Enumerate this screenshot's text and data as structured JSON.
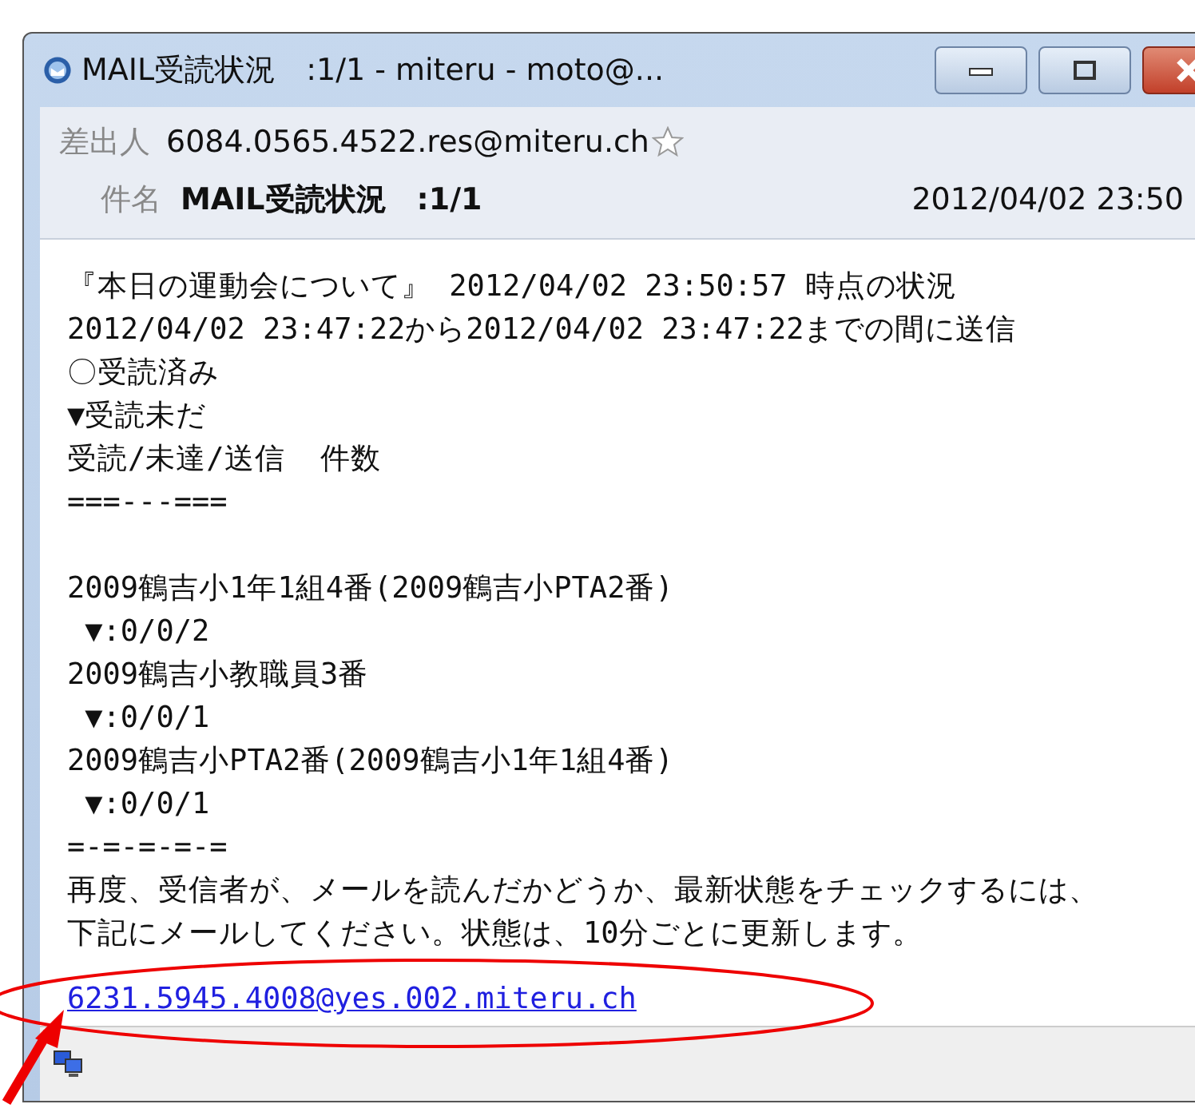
{
  "window": {
    "title": "MAIL受読状況　:1/1 - miteru - moto@..."
  },
  "header": {
    "from_label": "差出人",
    "from": "6084.0565.4522.res@miteru.ch",
    "subject_label": "件名",
    "subject": "MAIL受読状況　:1/1",
    "date": "2012/04/02 23:50"
  },
  "body": {
    "blocks": [
      [
        "『本日の運動会について』 2012/04/02 23:50:57 時点の状況",
        "2012/04/02 23:47:22から2012/04/02 23:47:22までの間に送信",
        "〇受読済み",
        "▼受読未だ",
        "受読/未達/送信  件数",
        "===---==="
      ],
      [
        "2009鶴吉小1年1組4番(2009鶴吉小PTA2番)",
        " ▼:0/0/2",
        "2009鶴吉小教職員3番",
        " ▼:0/0/1",
        "2009鶴吉小PTA2番(2009鶴吉小1年1組4番)",
        " ▼:0/0/1",
        "=-=-=-=-=",
        "再度、受信者が、メールを読んだかどうか、最新状態をチェックするには、",
        "下記にメールしてください。状態は、10分ごとに更新します。"
      ]
    ],
    "link": "6231.5945.4008@yes.002.miteru.ch"
  }
}
